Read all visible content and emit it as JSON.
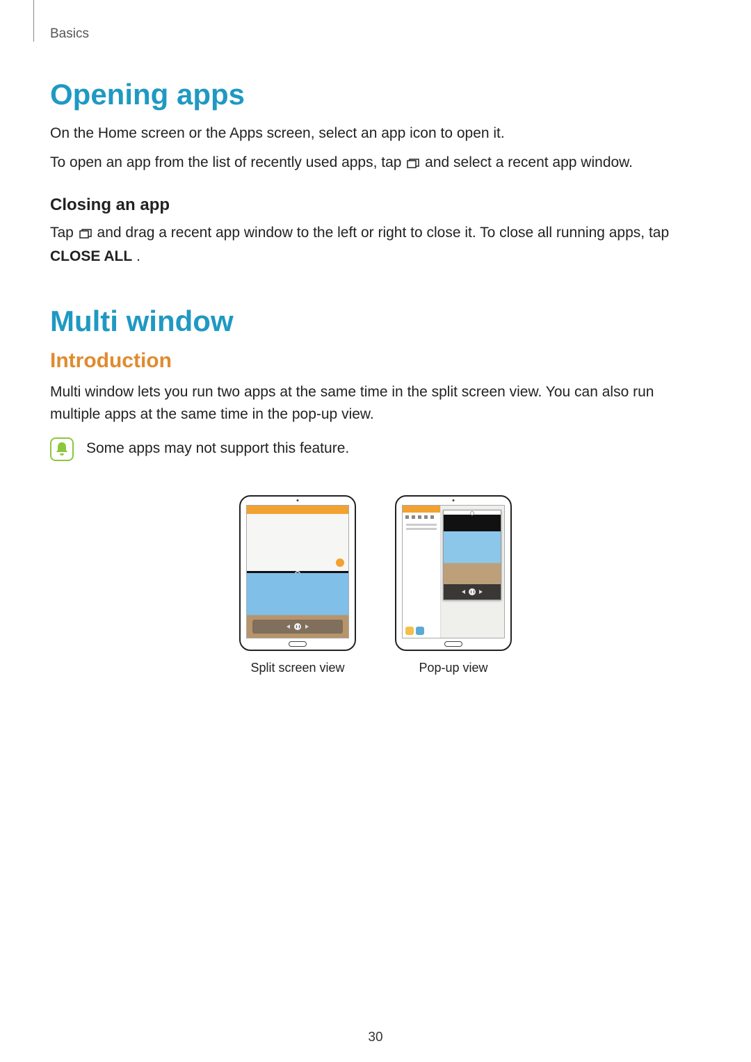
{
  "breadcrumb": "Basics",
  "section1": {
    "title": "Opening apps",
    "p1": "On the Home screen or the Apps screen, select an app icon to open it.",
    "p2a": "To open an app from the list of recently used apps, tap ",
    "p2b": " and select a recent app window.",
    "sub_heading": "Closing an app",
    "p3a": "Tap ",
    "p3b": " and drag a recent app window to the left or right to close it. To close all running apps, tap ",
    "p3_bold": "CLOSE ALL",
    "p3c": "."
  },
  "section2": {
    "title": "Multi window",
    "intro_heading": "Introduction",
    "intro_body": "Multi window lets you run two apps at the same time in the split screen view. You can also run multiple apps at the same time in the pop-up view.",
    "note": "Some apps may not support this feature.",
    "captions": {
      "split": "Split screen view",
      "popup": "Pop-up view"
    }
  },
  "page_number": "30"
}
